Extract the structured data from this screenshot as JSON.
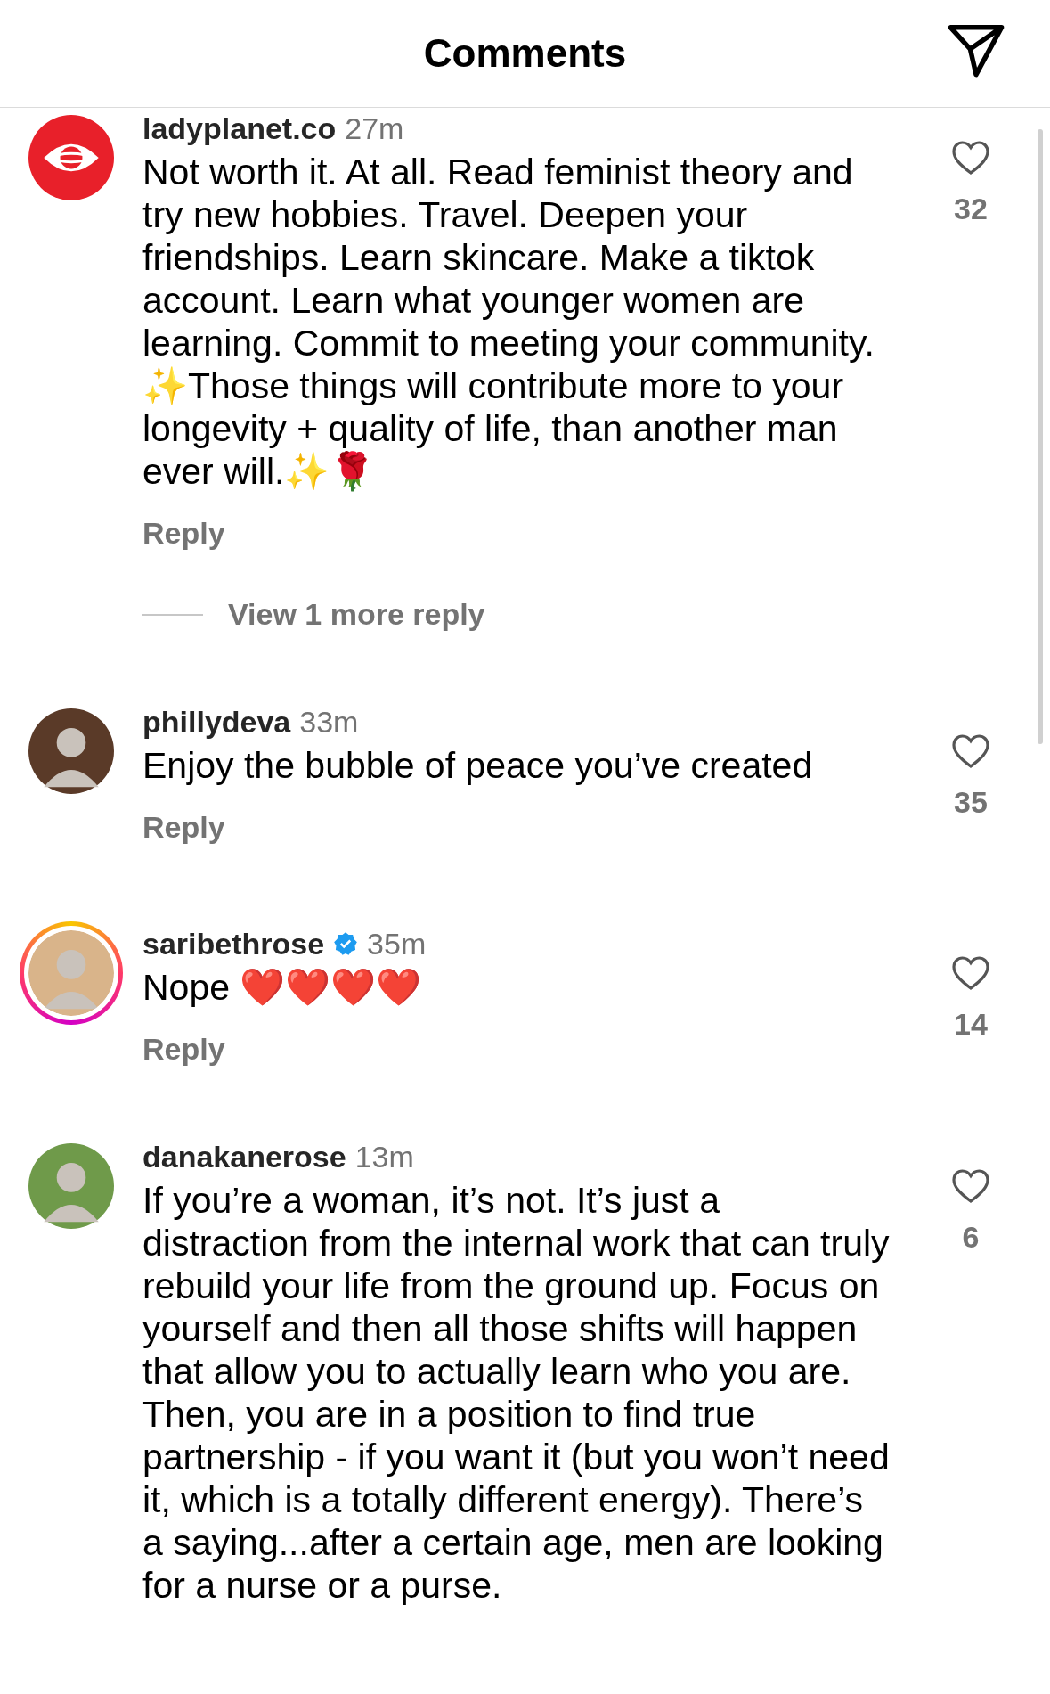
{
  "header": {
    "title": "Comments"
  },
  "comments": [
    {
      "kind": "logo",
      "story_ring": false,
      "username": "ladyplanet.co",
      "verified": false,
      "time": "27m",
      "text": "Not worth it. At all. Read feminist theory and try new hobbies. Travel. Deepen your friendships. Learn skincare. Make a tiktok account. Learn what younger women are learning. Commit to meeting your community. ✨Those things will contribute more to your longevity + quality of life, than another man ever will.✨🌹",
      "reply": "Reply",
      "likes": "32",
      "more_replies": "View 1 more reply"
    },
    {
      "kind": "person",
      "story_ring": false,
      "username": "phillydeva",
      "verified": false,
      "time": "33m",
      "text": "Enjoy the bubble of peace you’ve created",
      "reply": "Reply",
      "likes": "35"
    },
    {
      "kind": "person",
      "story_ring": true,
      "username": "saribethrose",
      "verified": true,
      "time": "35m",
      "text": "Nope ❤️❤️❤️❤️",
      "reply": "Reply",
      "likes": "14"
    },
    {
      "kind": "person",
      "story_ring": false,
      "username": "danakanerose",
      "verified": false,
      "time": "13m",
      "text": "If you’re a woman, it’s not. It’s just a distraction from the internal work that can truly rebuild your life from the ground up. Focus on yourself and then all those shifts will happen that allow you to actually learn who you are. Then, you are in a position to find true partnership - if you want it (but you won’t need it, which is a totally different energy). There’s a saying...after a certain age, men are looking for a nurse or a purse.",
      "likes": "6"
    }
  ]
}
